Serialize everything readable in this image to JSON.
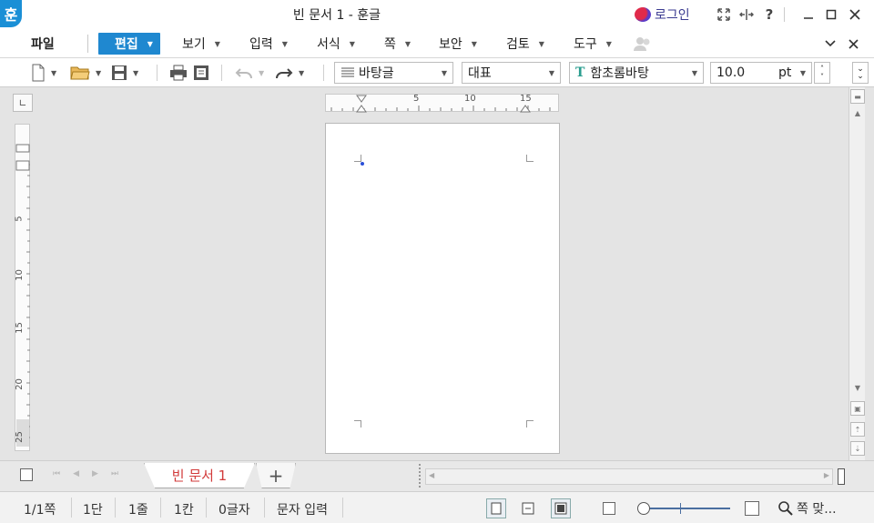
{
  "window": {
    "app_logo": "훈",
    "title": "빈 문서 1 - 훈글",
    "login_label": "로그인"
  },
  "menu": {
    "file": "파일",
    "items": [
      "편집",
      "보기",
      "입력",
      "서식",
      "쪽",
      "보안",
      "검토",
      "도구"
    ]
  },
  "toolbar": {
    "style_combo": "바탕글",
    "lang_combo": "대표",
    "font_combo": "함초롬바탕",
    "size_value": "10.0",
    "size_unit": "pt"
  },
  "ruler": {
    "h_ticks": [
      "5",
      "10",
      "15"
    ],
    "v_ticks": [
      "5",
      "10",
      "15",
      "20",
      "25"
    ]
  },
  "tabs": {
    "doc_tab": "빈 문서 1",
    "add": "+"
  },
  "status": {
    "page": "1/1쪽",
    "section": "1단",
    "line": "1줄",
    "column": "1칸",
    "chars": "0글자",
    "mode": "문자 입력",
    "zoom_label": "쪽 맞..."
  }
}
